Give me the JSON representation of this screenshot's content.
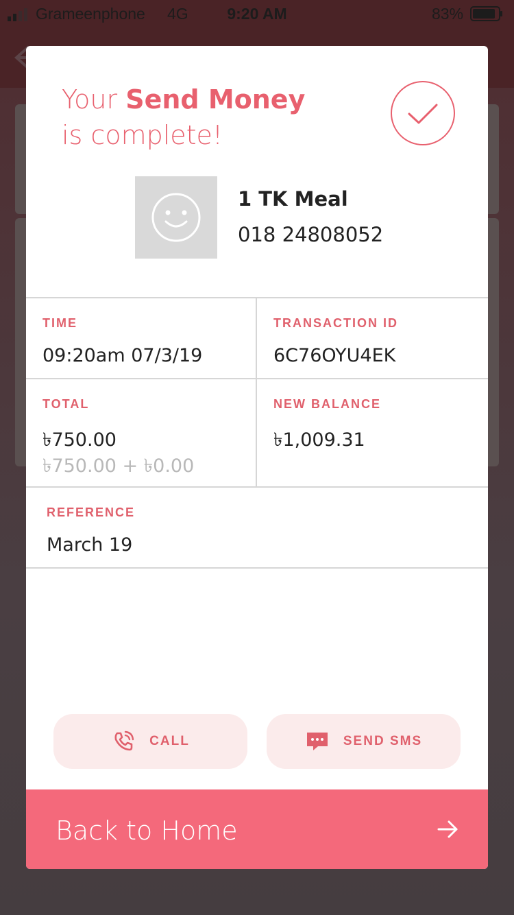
{
  "status_bar": {
    "carrier": "Grameenphone",
    "network": "4G",
    "time": "9:20 AM",
    "battery_percent": "83%"
  },
  "modal": {
    "title_prefix": "Your ",
    "title_strong": "Send Money",
    "title_suffix": "is complete!",
    "status_icon": "check-circle-icon",
    "recipient": {
      "avatar_icon": "smiley-face-icon",
      "name": "1 TK Meal",
      "number": "018 24808052"
    },
    "details": {
      "time_label": "TIME",
      "time_value": "09:20am 07/3/19",
      "transaction_id_label": "TRANSACTION ID",
      "transaction_id_value": "6C76OYU4EK",
      "total_label": "TOTAL",
      "total_value": "৳750.00",
      "total_breakdown": "৳750.00 + ৳0.00",
      "new_balance_label": "NEW BALANCE",
      "new_balance_value": "৳1,009.31",
      "reference_label": "REFERENCE",
      "reference_value": "March 19"
    },
    "actions": {
      "call_label": "CALL",
      "call_icon": "phone-ringing-icon",
      "sms_label": "SEND SMS",
      "sms_icon": "chat-bubble-icon"
    },
    "footer": {
      "label": "Back to Home",
      "icon": "arrow-right-icon"
    }
  },
  "colors": {
    "accent": "#e8606e",
    "footer_bg": "#f4697b",
    "pill_bg": "#fbebeb",
    "divider": "#d6d6d6",
    "overlay_top": "#4a2326"
  }
}
